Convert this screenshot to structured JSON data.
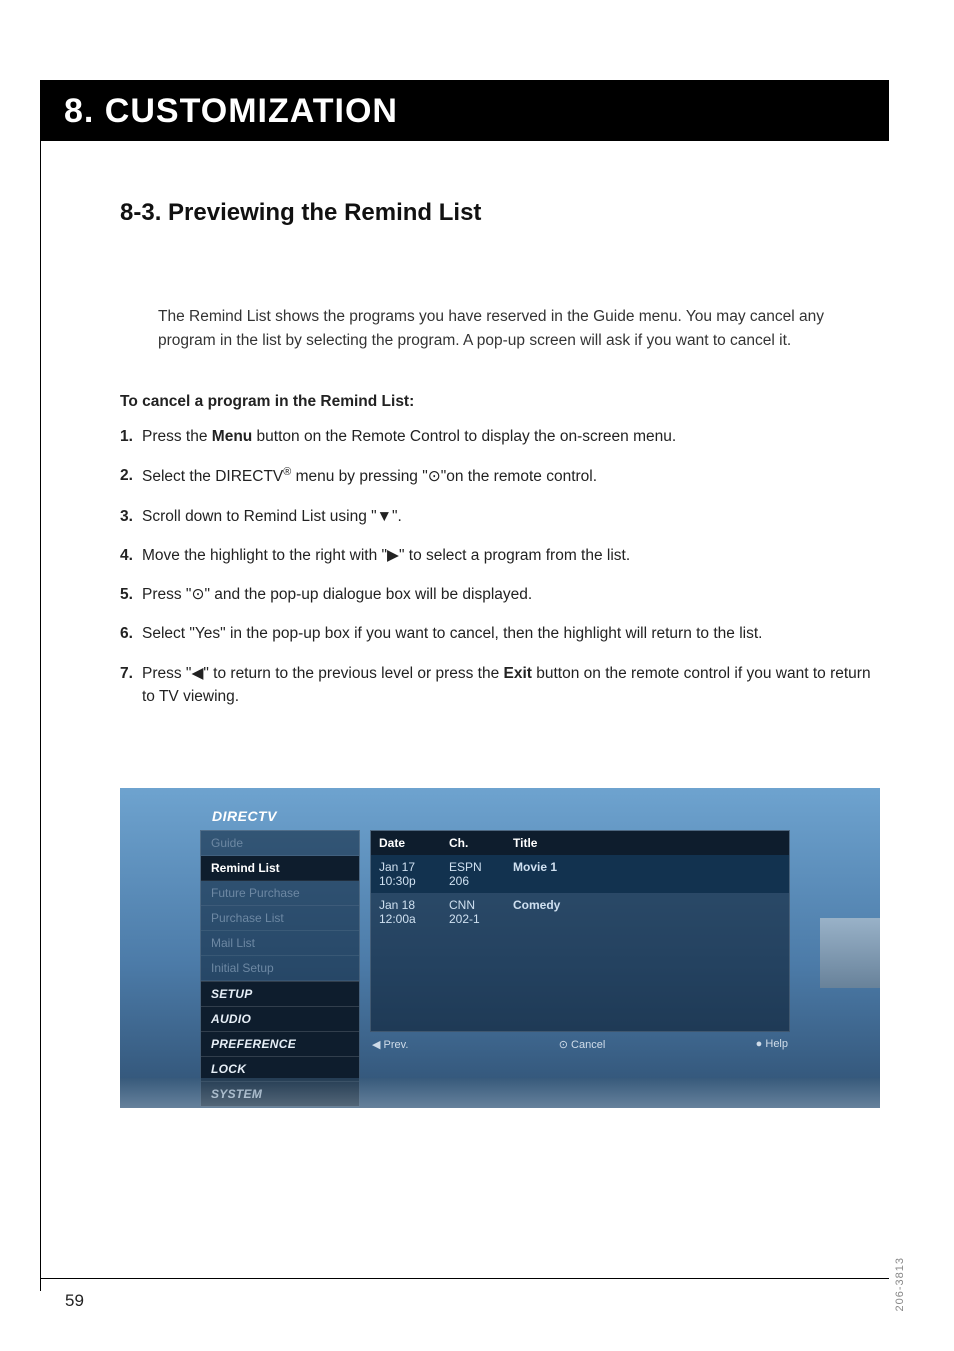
{
  "header": {
    "title": "8. CUSTOMIZATION"
  },
  "section": {
    "title": "8-3. Previewing the Remind List"
  },
  "intro": "The Remind List shows the programs you have reserved in the Guide menu.  You may cancel any program in the list by selecting the program.  A pop-up screen will ask if you want to cancel it.",
  "subheading": "To cancel a program in the Remind List:",
  "steps_text": {
    "s1_a": "Press the ",
    "s1_bold": "Menu",
    "s1_b": " button on the Remote Control to display the on-screen menu.",
    "s2_a": "Select the DIRECTV",
    "s2_b": " menu by pressing \"",
    "s2_c": "\"on the remote control.",
    "s3_a": "Scroll down to Remind List using \"",
    "s3_b": "\".",
    "s4_a": "Move the highlight to the right with \"",
    "s4_b": "\" to select a program from the list.",
    "s5_a": "Press \"",
    "s5_b": "\" and the pop-up dialogue box will be displayed.",
    "s6": "Select \"Yes\" in the pop-up box if you want to cancel, then the highlight will return to the list.",
    "s7_a": "Press \"",
    "s7_b": "\" to return to the previous level or press the ",
    "s7_bold": "Exit",
    "s7_c": " button on the remote control if you want to return to TV viewing."
  },
  "symbols": {
    "select": "⊙",
    "down": "▼",
    "right": "▶",
    "left": "◀",
    "reg": "®"
  },
  "nums": {
    "n1": "1.",
    "n2": "2.",
    "n3": "3.",
    "n4": "4.",
    "n5": "5.",
    "n6": "6.",
    "n7": "7."
  },
  "screenshot": {
    "brand": "DIRECTV",
    "left_menu": {
      "guide": "Guide",
      "remind": "Remind List",
      "future_purchase": "Future Purchase",
      "purchase_list": "Purchase List",
      "mail_list": "Mail List",
      "initial_setup": "Initial Setup",
      "setup": "SETUP",
      "audio": "AUDIO",
      "preference": "PREFERENCE",
      "lock": "LOCK",
      "system": "SYSTEM"
    },
    "table": {
      "head": {
        "date": "Date",
        "ch": "Ch.",
        "title": "Title"
      },
      "rows": [
        {
          "date": "Jan 17",
          "time": "10:30p",
          "ch": "ESPN",
          "chnum": "206",
          "title": "Movie 1"
        },
        {
          "date": "Jan 18",
          "time": "12:00a",
          "ch": "CNN",
          "chnum": "202-1",
          "title": "Comedy"
        }
      ]
    },
    "footer": {
      "prev": "◀ Prev.",
      "cancel": "⊙ Cancel",
      "help": "● Help"
    }
  },
  "page_number": "59",
  "doc_code": "206-3813"
}
